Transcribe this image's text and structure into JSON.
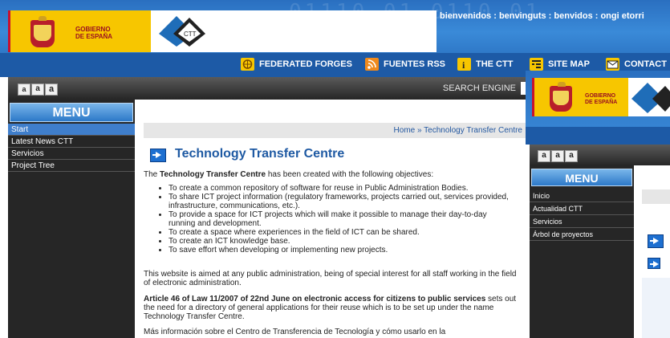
{
  "header": {
    "binary_deco": "01110 01 0110 01",
    "gov_line1": "GOBIERNO",
    "gov_line2": "DE ESPAÑA",
    "ctt_logo_text": "CTT",
    "welcome": "bienvenidos : benvinguts : benvidos : ongi etorri"
  },
  "nav": {
    "items": [
      {
        "label": "FEDERATED FORGES",
        "icon": "globe-icon"
      },
      {
        "label": "FUENTES RSS",
        "icon": "rss-icon"
      },
      {
        "label": "THE CTT",
        "icon": "info-icon"
      },
      {
        "label": "SITE MAP",
        "icon": "sitemap-icon"
      },
      {
        "label": "CONTACT",
        "icon": "mail-icon"
      }
    ]
  },
  "toolbar": {
    "font_sizes": [
      "a",
      "a",
      "a"
    ],
    "search_label": "SEARCH ENGINE"
  },
  "sidebar": {
    "title": "MENU",
    "items": [
      {
        "label": "Start",
        "active": true
      },
      {
        "label": "Latest News CTT",
        "active": false
      },
      {
        "label": "Servicios",
        "active": false
      },
      {
        "label": "Project Tree",
        "active": false
      }
    ]
  },
  "content": {
    "breadcrumb": "Home » Technology Transfer Centre",
    "title": "Technology Transfer Centre",
    "intro_bold": "Technology Transfer Centre",
    "intro_pre": "The ",
    "intro_post": " has been created with the following objectives:",
    "objectives": [
      "To create a common repository of software for reuse in Public Administration Bodies.",
      "To share ICT project information (regulatory frameworks, projects carried out, services provided, infrastructure, communications, etc.).",
      "To provide a space for ICT projects which will make it possible to manage their day-to-day running and development.",
      "To create a space where experiences in the field of ICT can be shared.",
      "To create an ICT knowledge base.",
      "To save effort when developing or implementing new projects."
    ],
    "para2": "This website is aimed at any public administration, being of special interest for all staff working in the field of electronic administration.",
    "para3_bold": "Article 46 of Law 11/2007 of 22nd June on electronic access for citizens to public services",
    "para3_rest": " sets out the need for a directory of general applications for their reuse which is to be set up under the name Technology Transfer Centre.",
    "para4": "Más información sobre el Centro de Transferencia de Tecnología y cómo usarlo en la"
  },
  "overlay": {
    "gov_line1": "GOBIERNO",
    "gov_line2": "DE ESPAÑA",
    "font_sizes": [
      "a",
      "a",
      "a"
    ],
    "menu_title": "MENU",
    "menu_items": [
      "Inicio",
      "Actualidad CTT",
      "Servicios",
      "Árbol de proyectos"
    ]
  },
  "colors": {
    "brand_blue": "#1d5aa6",
    "gov_yellow": "#f7c600",
    "menu_active": "#3f7ecb",
    "title_blue": "#1f5aa3"
  }
}
